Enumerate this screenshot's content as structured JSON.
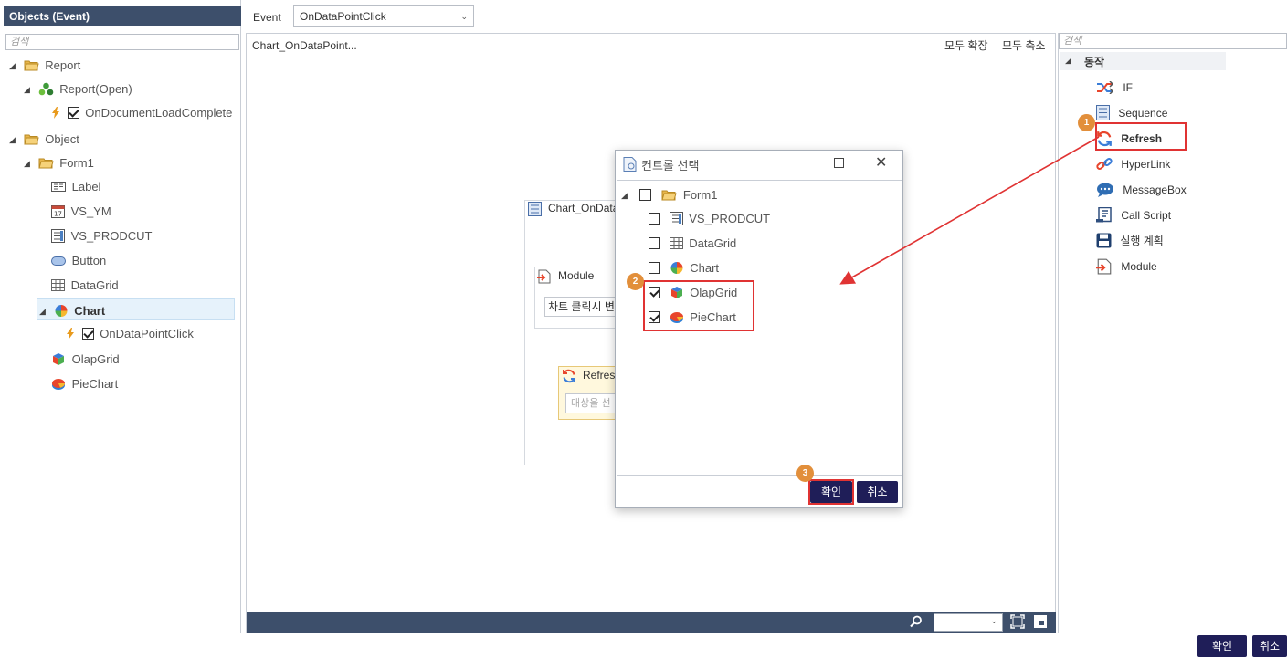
{
  "left_panel": {
    "title": "Objects (Event)",
    "search_placeholder": "검색",
    "tree": {
      "report": "Report",
      "report_open": "Report(Open)",
      "on_document_load_complete": "OnDocumentLoadComplete",
      "object": "Object",
      "form1": "Form1",
      "label": "Label",
      "vs_ym": "VS_YM",
      "vs_prodcut": "VS_PRODCUT",
      "button": "Button",
      "datagrid": "DataGrid",
      "chart": "Chart",
      "on_data_point_click": "OnDataPointClick",
      "olapgrid": "OlapGrid",
      "piechart": "PieChart"
    }
  },
  "event_bar": {
    "label": "Event",
    "selected": "OnDataPointClick"
  },
  "canvas": {
    "title": "Chart_OnDataPoint...",
    "expand_all": "모두 확장",
    "collapse_all": "모두 축소",
    "node_title": "Chart_OnData",
    "module_title": "Module",
    "module_text": "차트 클릭시 변",
    "refresh_title": "Refresh",
    "refresh_placeholder": "대상을 선"
  },
  "right_panel": {
    "search_placeholder": "검색",
    "group": "동작",
    "actions": {
      "if": "IF",
      "sequence": "Sequence",
      "refresh": "Refresh",
      "hyperlink": "HyperLink",
      "messagebox": "MessageBox",
      "call_script": "Call Script",
      "exec_plan": "실행 계획",
      "module": "Module"
    }
  },
  "dialog": {
    "title": "컨트롤 선택",
    "tree": {
      "form1": "Form1",
      "vs_prodcut": "VS_PRODCUT",
      "datagrid": "DataGrid",
      "chart": "Chart",
      "olapgrid": "OlapGrid",
      "piechart": "PieChart"
    },
    "ok": "확인",
    "cancel": "취소"
  },
  "footer": {
    "ok": "확인",
    "cancel": "취소"
  },
  "badges": {
    "b1": "1",
    "b2": "2",
    "b3": "3"
  },
  "colors": {
    "header_bg": "#3d4f6b",
    "button_bg": "#1f1e58",
    "highlight_red": "#e03333",
    "badge_orange": "#e28f3b"
  }
}
